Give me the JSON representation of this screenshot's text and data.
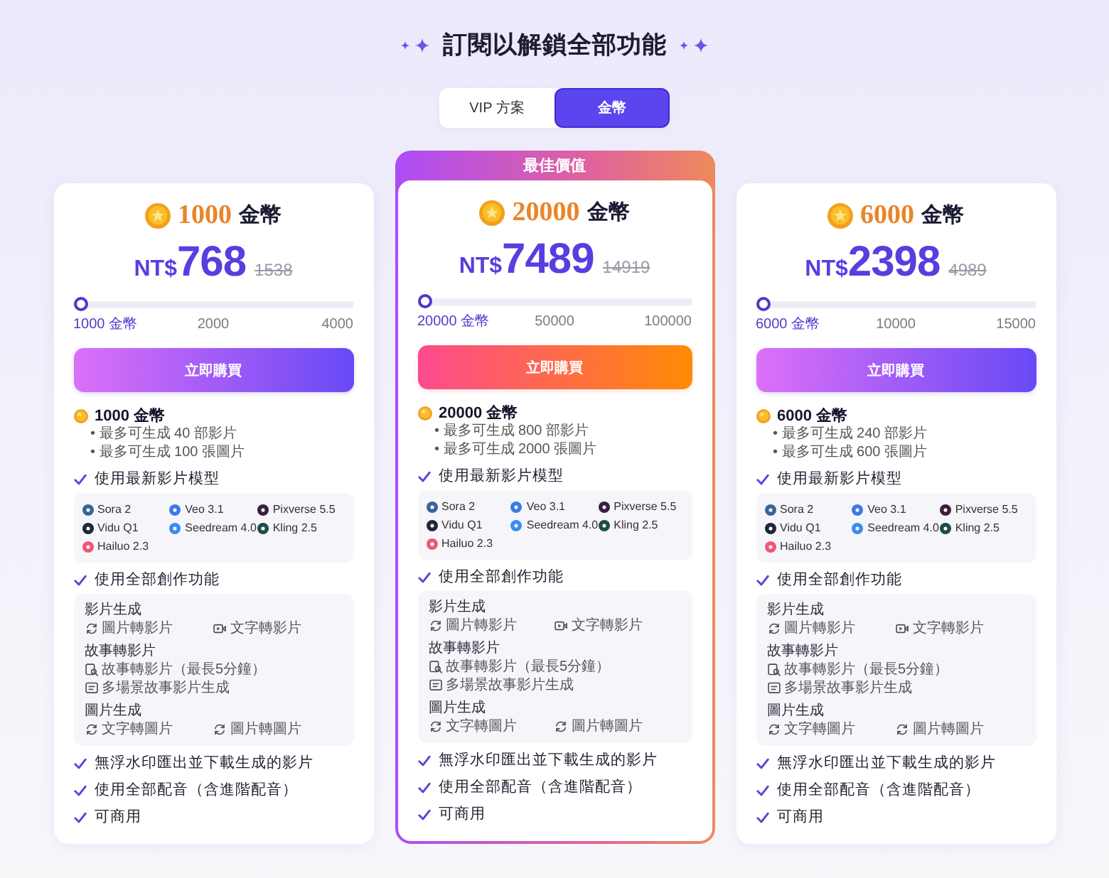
{
  "title": "訂閱以解鎖全部功能",
  "tabs": [
    {
      "label": "VIP 方案",
      "selected": false
    },
    {
      "label": "金幣",
      "selected": true
    }
  ],
  "plans": [
    {
      "featured": false,
      "coins": "1000",
      "unit": "金幣",
      "currency": "NT$",
      "price": "768",
      "original_price": "1538",
      "slider": {
        "level": 0,
        "stops": [
          {
            "label": "1000 金幣",
            "selected": true
          },
          {
            "label": "2000",
            "selected": false
          },
          {
            "label": "4000",
            "selected": false
          }
        ]
      },
      "buy_button": "立即購買",
      "summary": {
        "title": "1000 金幣",
        "lines": [
          "• 最多可生成 40 部影片",
          "• 最多可生成 100 張圖片"
        ]
      },
      "benefits": [
        {
          "kind": "models",
          "label": "使用最新影片模型",
          "models": [
            {
              "name": "Sora 2",
              "color": "#35659a"
            },
            {
              "name": "Veo 3.1",
              "color": "#3b7ae6"
            },
            {
              "name": "Pixverse 5.5",
              "color": "#3a1e40"
            },
            {
              "name": "Vidu Q1",
              "color": "#1e2736"
            },
            {
              "name": "Seedream 4.0",
              "color": "#3a8cf0"
            },
            {
              "name": "Kling 2.5",
              "color": "#1d4d49"
            },
            {
              "name": "Hailuo 2.3",
              "color": "#ef5878"
            }
          ]
        },
        {
          "kind": "tools",
          "label": "使用全部創作功能",
          "groups": [
            {
              "title": "影片生成",
              "items": [
                "圖片轉影片",
                "文字轉影片"
              ]
            },
            {
              "title": "故事轉影片",
              "items": [
                "故事轉影片（最長5分鐘）",
                "多場景故事影片生成"
              ]
            },
            {
              "title": "圖片生成",
              "items": [
                "文字轉圖片",
                "圖片轉圖片"
              ]
            }
          ]
        },
        {
          "kind": "plain",
          "label": "無浮水印匯出並下載生成的影片"
        },
        {
          "kind": "plain",
          "label": "使用全部配音（含進階配音）"
        },
        {
          "kind": "plain",
          "label": "可商用"
        }
      ]
    },
    {
      "featured": true,
      "badge": "最佳價值",
      "coins": "20000",
      "unit": "金幣",
      "currency": "NT$",
      "price": "7489",
      "original_price": "14919",
      "slider": {
        "level": 0,
        "stops": [
          {
            "label": "20000 金幣",
            "selected": true
          },
          {
            "label": "50000",
            "selected": false
          },
          {
            "label": "100000",
            "selected": false
          }
        ]
      },
      "buy_button": "立即購買",
      "summary": {
        "title": "20000 金幣",
        "lines": [
          "• 最多可生成 800 部影片",
          "• 最多可生成 2000 張圖片"
        ]
      },
      "benefits": [
        {
          "kind": "models",
          "label": "使用最新影片模型",
          "models": [
            {
              "name": "Sora 2",
              "color": "#35659a"
            },
            {
              "name": "Veo 3.1",
              "color": "#3b7ae6"
            },
            {
              "name": "Pixverse 5.5",
              "color": "#3a1e40"
            },
            {
              "name": "Vidu Q1",
              "color": "#1e2736"
            },
            {
              "name": "Seedream 4.0",
              "color": "#3a8cf0"
            },
            {
              "name": "Kling 2.5",
              "color": "#1d4d49"
            },
            {
              "name": "Hailuo 2.3",
              "color": "#ef5878"
            }
          ]
        },
        {
          "kind": "tools",
          "label": "使用全部創作功能",
          "groups": [
            {
              "title": "影片生成",
              "items": [
                "圖片轉影片",
                "文字轉影片"
              ]
            },
            {
              "title": "故事轉影片",
              "items": [
                "故事轉影片（最長5分鐘）",
                "多場景故事影片生成"
              ]
            },
            {
              "title": "圖片生成",
              "items": [
                "文字轉圖片",
                "圖片轉圖片"
              ]
            }
          ]
        },
        {
          "kind": "plain",
          "label": "無浮水印匯出並下載生成的影片"
        },
        {
          "kind": "plain",
          "label": "使用全部配音（含進階配音）"
        },
        {
          "kind": "plain",
          "label": "可商用"
        }
      ]
    },
    {
      "featured": false,
      "coins": "6000",
      "unit": "金幣",
      "currency": "NT$",
      "price": "2398",
      "original_price": "4989",
      "slider": {
        "level": 0,
        "stops": [
          {
            "label": "6000 金幣",
            "selected": true
          },
          {
            "label": "10000",
            "selected": false
          },
          {
            "label": "15000",
            "selected": false
          }
        ]
      },
      "buy_button": "立即購買",
      "summary": {
        "title": "6000 金幣",
        "lines": [
          "• 最多可生成 240 部影片",
          "• 最多可生成 600 張圖片"
        ]
      },
      "benefits": [
        {
          "kind": "models",
          "label": "使用最新影片模型",
          "models": [
            {
              "name": "Sora 2",
              "color": "#35659a"
            },
            {
              "name": "Veo 3.1",
              "color": "#3b7ae6"
            },
            {
              "name": "Pixverse 5.5",
              "color": "#3a1e40"
            },
            {
              "name": "Vidu Q1",
              "color": "#1e2736"
            },
            {
              "name": "Seedream 4.0",
              "color": "#3a8cf0"
            },
            {
              "name": "Kling 2.5",
              "color": "#1d4d49"
            },
            {
              "name": "Hailuo 2.3",
              "color": "#ef5878"
            }
          ]
        },
        {
          "kind": "tools",
          "label": "使用全部創作功能",
          "groups": [
            {
              "title": "影片生成",
              "items": [
                "圖片轉影片",
                "文字轉影片"
              ]
            },
            {
              "title": "故事轉影片",
              "items": [
                "故事轉影片（最長5分鐘）",
                "多場景故事影片生成"
              ]
            },
            {
              "title": "圖片生成",
              "items": [
                "文字轉圖片",
                "圖片轉圖片"
              ]
            }
          ]
        },
        {
          "kind": "plain",
          "label": "無浮水印匯出並下載生成的影片"
        },
        {
          "kind": "plain",
          "label": "使用全部配音（含進階配音）"
        },
        {
          "kind": "plain",
          "label": "可商用"
        }
      ]
    }
  ]
}
